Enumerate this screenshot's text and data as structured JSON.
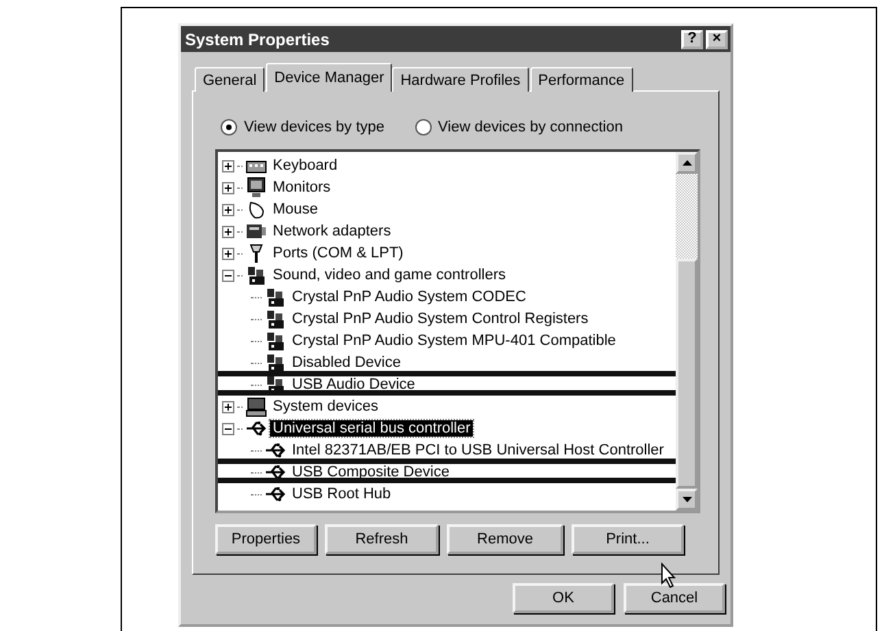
{
  "window": {
    "title": "System Properties",
    "help": "?",
    "close": "×"
  },
  "tabs": [
    {
      "label": "General",
      "selected": false
    },
    {
      "label": "Device Manager",
      "selected": true
    },
    {
      "label": "Hardware Profiles",
      "selected": false
    },
    {
      "label": "Performance",
      "selected": false
    }
  ],
  "view_options": [
    {
      "label": "View devices by type",
      "selected": true
    },
    {
      "label": "View devices by connection",
      "selected": false
    }
  ],
  "tree": [
    {
      "label": "Keyboard",
      "kind": "keyboard",
      "expanded": false,
      "selected": false,
      "highlighted": false
    },
    {
      "label": "Monitors",
      "kind": "monitor",
      "expanded": false,
      "selected": false,
      "highlighted": false
    },
    {
      "label": "Mouse",
      "kind": "mouse",
      "expanded": false,
      "selected": false,
      "highlighted": false
    },
    {
      "label": "Network adapters",
      "kind": "network",
      "expanded": false,
      "selected": false,
      "highlighted": false
    },
    {
      "label": "Ports (COM & LPT)",
      "kind": "port",
      "expanded": false,
      "selected": false,
      "highlighted": false
    },
    {
      "label": "Sound, video and game controllers",
      "kind": "sound",
      "expanded": true,
      "selected": false,
      "highlighted": false,
      "children": [
        {
          "label": "Crystal PnP Audio System CODEC",
          "kind": "sound",
          "selected": false,
          "highlighted": false
        },
        {
          "label": "Crystal PnP Audio System Control Registers",
          "kind": "sound",
          "selected": false,
          "highlighted": false
        },
        {
          "label": "Crystal PnP Audio System MPU-401 Compatible",
          "kind": "sound",
          "selected": false,
          "highlighted": false
        },
        {
          "label": "Disabled Device",
          "kind": "sound",
          "selected": false,
          "highlighted": false
        },
        {
          "label": "USB Audio Device",
          "kind": "sound",
          "selected": false,
          "highlighted": true
        }
      ]
    },
    {
      "label": "System devices",
      "kind": "system",
      "expanded": false,
      "selected": false,
      "highlighted": false
    },
    {
      "label": "Universal serial bus controller",
      "kind": "usb",
      "expanded": true,
      "selected": true,
      "highlighted": false,
      "children": [
        {
          "label": "Intel 82371AB/EB PCI to USB Universal Host Controller",
          "kind": "usb",
          "selected": false,
          "highlighted": false
        },
        {
          "label": "USB Composite Device",
          "kind": "usb",
          "selected": false,
          "highlighted": true
        },
        {
          "label": "USB Root Hub",
          "kind": "usb",
          "selected": false,
          "highlighted": false
        }
      ]
    }
  ],
  "actions": [
    "Properties",
    "Refresh",
    "Remove",
    "Print..."
  ],
  "dialog_buttons": [
    "OK",
    "Cancel"
  ]
}
